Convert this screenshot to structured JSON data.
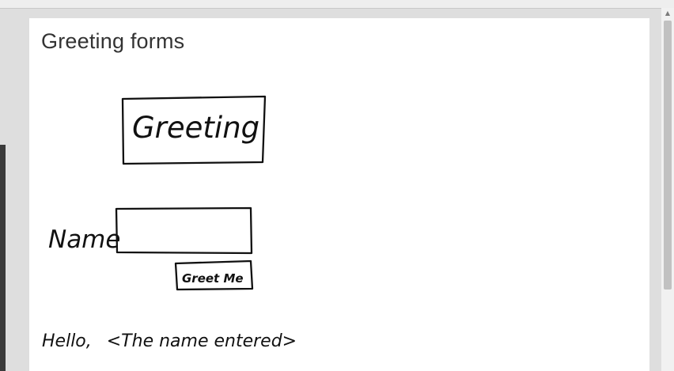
{
  "page": {
    "title": "Greeting forms"
  },
  "mockup": {
    "heading_box_text": "Greeting",
    "name_label": "Name",
    "button_label": "Greet Me",
    "greeting_text": "Hello, ",
    "greeting_placeholder": "<The name entered>"
  },
  "scrollbar": {
    "up_arrow_icon": "▲"
  }
}
